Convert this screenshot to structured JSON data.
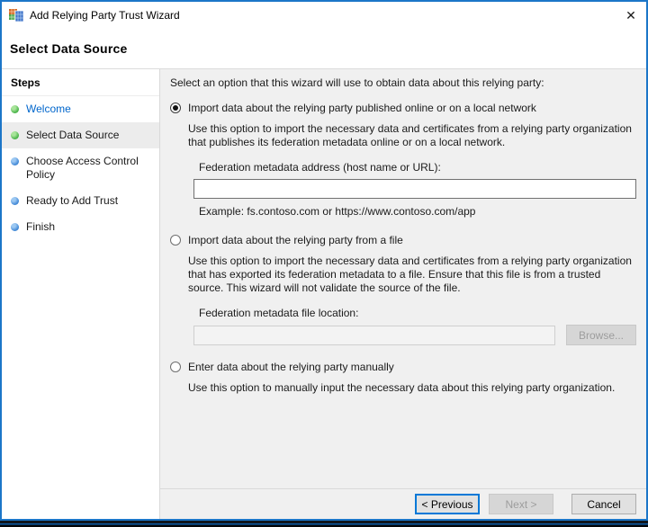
{
  "window": {
    "title": "Add Relying Party Trust Wizard",
    "close_glyph": "✕"
  },
  "page": {
    "title": "Select Data Source"
  },
  "steps": {
    "header": "Steps",
    "items": [
      {
        "label": "Welcome",
        "bullet": "green",
        "state": "done-link"
      },
      {
        "label": "Select Data Source",
        "bullet": "green",
        "state": "current"
      },
      {
        "label": "Choose Access Control Policy",
        "bullet": "blue",
        "state": "upcoming"
      },
      {
        "label": "Ready to Add Trust",
        "bullet": "blue",
        "state": "upcoming"
      },
      {
        "label": "Finish",
        "bullet": "blue",
        "state": "upcoming"
      }
    ]
  },
  "content": {
    "intro": "Select an option that this wizard will use to obtain data about this relying party:",
    "options": [
      {
        "label": "Import data about the relying party published online or on a local network",
        "selected": true,
        "description": "Use this option to import the necessary data and certificates from a relying party organization that publishes its federation metadata online or on a local network.",
        "field_label": "Federation metadata address (host name or URL):",
        "field_value": "",
        "example": "Example: fs.contoso.com or https://www.contoso.com/app"
      },
      {
        "label": "Import data about the relying party from a file",
        "selected": false,
        "description": "Use this option to import the necessary data and certificates from a relying party organization that has exported its federation metadata to a file. Ensure that this file is from a trusted source.  This wizard will not validate the source of the file.",
        "field_label": "Federation metadata file location:",
        "field_value": "",
        "browse_label": "Browse..."
      },
      {
        "label": "Enter data about the relying party manually",
        "selected": false,
        "description": "Use this option to manually input the necessary data about this relying party organization."
      }
    ]
  },
  "footer": {
    "previous_label": "< Previous",
    "next_label": "Next >",
    "cancel_label": "Cancel"
  },
  "colors": {
    "window_border": "#1c76c8",
    "focus_blue": "#0078d7",
    "panel_gray": "#f0f0f0",
    "step_done_bullet": "#47b347",
    "step_upcoming_bullet": "#3f87d6",
    "welcome_link": "#0066cc"
  }
}
